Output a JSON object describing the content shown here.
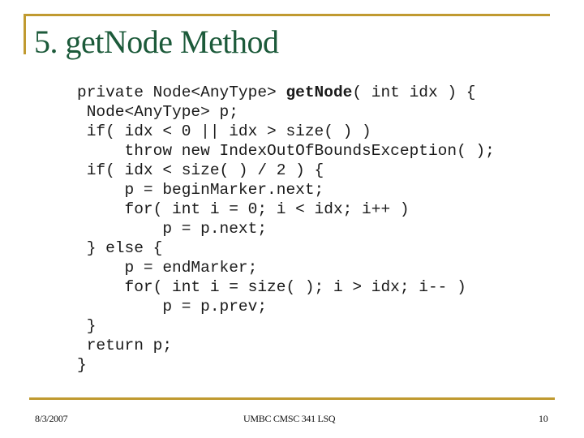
{
  "slide": {
    "title": "5. getNode Method",
    "code_lines": [
      {
        "pre": "private Node<AnyType> ",
        "bold": "getNode",
        "post": "( int idx ) {"
      },
      {
        "pre": " Node<AnyType> p;",
        "bold": "",
        "post": ""
      },
      {
        "pre": " if( idx < 0 || idx > size( ) )",
        "bold": "",
        "post": ""
      },
      {
        "pre": "     throw new IndexOutOfBoundsException( );",
        "bold": "",
        "post": ""
      },
      {
        "pre": " if( idx < size( ) / 2 ) {",
        "bold": "",
        "post": ""
      },
      {
        "pre": "     p = beginMarker.next;",
        "bold": "",
        "post": ""
      },
      {
        "pre": "     for( int i = 0; i < idx; i++ )",
        "bold": "",
        "post": ""
      },
      {
        "pre": "         p = p.next;",
        "bold": "",
        "post": ""
      },
      {
        "pre": " } else {",
        "bold": "",
        "post": ""
      },
      {
        "pre": "     p = endMarker;",
        "bold": "",
        "post": ""
      },
      {
        "pre": "     for( int i = size( ); i > idx; i-- )",
        "bold": "",
        "post": ""
      },
      {
        "pre": "         p = p.prev;",
        "bold": "",
        "post": ""
      },
      {
        "pre": " }",
        "bold": "",
        "post": ""
      },
      {
        "pre": " return p;",
        "bold": "",
        "post": ""
      },
      {
        "pre": "}",
        "bold": "",
        "post": ""
      }
    ]
  },
  "footer": {
    "date": "8/3/2007",
    "course": "UMBC CMSC 341 LSQ",
    "page_number": "10"
  },
  "colors": {
    "accent_rule": "#c09a30",
    "title": "#1c5a3a"
  }
}
